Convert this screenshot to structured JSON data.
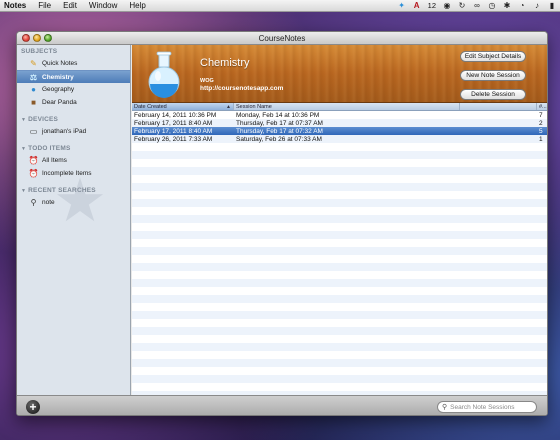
{
  "menubar": {
    "app_name": "Notes",
    "menus": [
      "File",
      "Edit",
      "Window",
      "Help"
    ],
    "status_text": "12"
  },
  "window": {
    "title": "CourseNotes"
  },
  "sidebar": {
    "sections": [
      {
        "label": "SUBJECTS",
        "items": [
          {
            "label": "Quick Notes",
            "icon": "pencil-icon"
          },
          {
            "label": "Chemistry",
            "icon": "flask-icon",
            "selected": true
          },
          {
            "label": "Geography",
            "icon": "globe-icon"
          },
          {
            "label": "Dear Panda",
            "icon": "book-icon"
          }
        ]
      },
      {
        "label": "DEVICES",
        "items": [
          {
            "label": "jonathan's iPad",
            "icon": "ipad-icon"
          }
        ]
      },
      {
        "label": "TODO ITEMS",
        "items": [
          {
            "label": "All Items",
            "icon": "alarm-clock-icon"
          },
          {
            "label": "Incomplete Items",
            "icon": "alarm-clock-icon"
          }
        ]
      },
      {
        "label": "RECENT SEARCHES",
        "items": [
          {
            "label": "note",
            "icon": "search-icon"
          }
        ]
      }
    ]
  },
  "subject": {
    "name": "Chemistry",
    "sub": "WOG",
    "url": "http://coursenotesapp.com"
  },
  "actions": {
    "edit_label": "Edit Subject Details",
    "new_label": "New Note Session",
    "delete_label": "Delete Session"
  },
  "table": {
    "columns": [
      "Date Created",
      "Session Name",
      "#..."
    ],
    "rows": [
      {
        "date": "February 14, 2011 10:36 PM",
        "name": "Monday, Feb 14 at 10:36 PM",
        "count": "7"
      },
      {
        "date": "February 17, 2011 8:40 AM",
        "name": "Thursday, Feb 17 at 07:37 AM",
        "count": "2"
      },
      {
        "date": "February 17, 2011 8:40 AM",
        "name": "Thursday, Feb 17 at 07:32 AM",
        "count": "5",
        "selected": true
      },
      {
        "date": "February 26, 2011 7:33 AM",
        "name": "Saturday, Feb 26 at 07:33 AM",
        "count": "1"
      }
    ]
  },
  "search": {
    "placeholder": "Search Note Sessions"
  },
  "colors": {
    "selection": "#2f67b8",
    "wood": "#b86620",
    "sidebar_bg": "#dde4ec"
  }
}
